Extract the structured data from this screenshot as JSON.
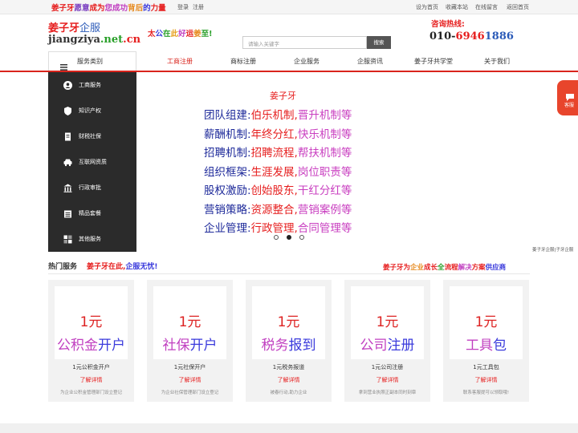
{
  "topbar": {
    "slogan": [
      {
        "t": "姜子牙",
        "c": "#e61e1e"
      },
      {
        "t": "愿意",
        "c": "#7a3fc0"
      },
      {
        "t": "成为",
        "c": "#e61e1e"
      },
      {
        "t": "您成功",
        "c": "#c03fc0"
      },
      {
        "t": "背后",
        "c": "#e68a1e"
      },
      {
        "t": "的",
        "c": "#3a3adc"
      },
      {
        "t": "力量",
        "c": "#e61e1e"
      }
    ],
    "login": "登录",
    "register": "注册",
    "links": [
      "设为首页",
      "收藏本站",
      "在线留言",
      "返回首页"
    ]
  },
  "header": {
    "logo_cn_red": "姜子牙",
    "logo_cn_blue": "企服",
    "logo_en_a": "jiangziya",
    "logo_en_b": ".net",
    "logo_en_c": ".cn",
    "tagline": [
      {
        "t": "太",
        "c": "#e61e1e"
      },
      {
        "t": "公",
        "c": "#3a3adc"
      },
      {
        "t": "在",
        "c": "#2aa02a"
      },
      {
        "t": "此",
        "c": "#e6a01e"
      },
      {
        "t": "好",
        "c": "#c03fc0"
      },
      {
        "t": "运",
        "c": "#e61e1e"
      },
      {
        "t": "姜",
        "c": "#e68a1e"
      },
      {
        "t": "至",
        "c": "#2aa02a"
      },
      {
        "t": "!",
        "c": "#2aa02a"
      }
    ],
    "search_placeholder": "请输入关键字",
    "search_button": "搜索",
    "hotline_label": "咨询热线:",
    "hotline_a": "010-",
    "hotline_b": "69461886"
  },
  "nav": {
    "category_label": "服务类别",
    "items": [
      "工商注册",
      "商标注册",
      "企业服务",
      "企服资讯",
      "姜子牙共学堂",
      "关于我们"
    ]
  },
  "sidebar": {
    "items": [
      {
        "label": "工商服务",
        "icon": "user-circle-icon"
      },
      {
        "label": "知识产权",
        "icon": "badge-icon"
      },
      {
        "label": "财税社保",
        "icon": "document-icon"
      },
      {
        "label": "互联网资质",
        "icon": "car-icon"
      },
      {
        "label": "行政审批",
        "icon": "building-icon"
      },
      {
        "label": "精品套餐",
        "icon": "calendar-icon"
      },
      {
        "label": "其他服务",
        "icon": "grid-icon"
      }
    ]
  },
  "banner": {
    "title": "姜子牙",
    "lines": [
      {
        "k": "团队组建:",
        "a": "伯乐机制,",
        "b": "晋升机制等"
      },
      {
        "k": "薪酬机制:",
        "a": "年终分红,",
        "b": "快乐机制等"
      },
      {
        "k": "招聘机制:",
        "a": "招聘流程,",
        "b": "帮扶机制等"
      },
      {
        "k": "组织框架:",
        "a": "生涯发展,",
        "b": "岗位职责等"
      },
      {
        "k": "股权激励:",
        "a": "创始股东,",
        "b": "干红分红等"
      },
      {
        "k": "营销策略:",
        "a": "资源整合,",
        "b": "营销案例等"
      },
      {
        "k": "企业管理:",
        "a": "行政管理,",
        "b": "合同管理等"
      }
    ],
    "caption": "姜子牙企服|子牙企服",
    "active_slide": 2
  },
  "float_tab": {
    "label": "客服",
    "icon": "chat-icon"
  },
  "hot": {
    "title": "热门服务",
    "sub_a": "姜子牙在此,",
    "sub_b": "企服无忧!",
    "right": [
      {
        "t": "姜子牙为",
        "c": "#e61e1e"
      },
      {
        "t": "企业",
        "c": "#e68a1e"
      },
      {
        "t": "成长",
        "c": "#e61e1e"
      },
      {
        "t": "全",
        "c": "#2aa02a"
      },
      {
        "t": "流程",
        "c": "#e61e1e"
      },
      {
        "t": "解决",
        "c": "#c03fc0"
      },
      {
        "t": "方案",
        "c": "#e61e1e"
      },
      {
        "t": "供应",
        "c": "#3a3adc"
      },
      {
        "t": "商",
        "c": "#3a3adc"
      }
    ],
    "cards": [
      {
        "price": "1元",
        "big_a": "公积金",
        "big_a_c": "#c03fc0",
        "big_b": "开户",
        "big_b_c": "#3a3adc",
        "name": "1元公积金开户",
        "detail": "了解详情",
        "desc": "为企业公积金管理部门设立登记"
      },
      {
        "price": "1元",
        "big_a": "社保",
        "big_a_c": "#c03fc0",
        "big_b": "开户",
        "big_b_c": "#3a3adc",
        "name": "1元社保开户",
        "detail": "了解详情",
        "desc": "为企业社保管理部门设立登记"
      },
      {
        "price": "1元",
        "big_a": "税务",
        "big_a_c": "#c03fc0",
        "big_b": "报到",
        "big_b_c": "#3a3adc",
        "name": "1元税务报道",
        "detail": "了解详情",
        "desc": "被春行动,助力企业"
      },
      {
        "price": "1元",
        "big_a": "公司",
        "big_a_c": "#c03fc0",
        "big_b": "注册",
        "big_b_c": "#3a3adc",
        "name": "1元公司注册",
        "detail": "了解详情",
        "desc": "拿到营业执照正副本同时刻章"
      },
      {
        "price": "1元",
        "big_a": "工具",
        "big_a_c": "#c03fc0",
        "big_b": "包",
        "big_b_c": "#3a3adc",
        "name": "1元工具包",
        "detail": "了解详情",
        "desc": "联系客服提可以领取哦!"
      }
    ]
  },
  "colors": {
    "accent": "#d9241c",
    "key_blue": "#1e2a9a",
    "banner_red": "#e61e1e",
    "banner_magenta": "#c93fc0"
  }
}
